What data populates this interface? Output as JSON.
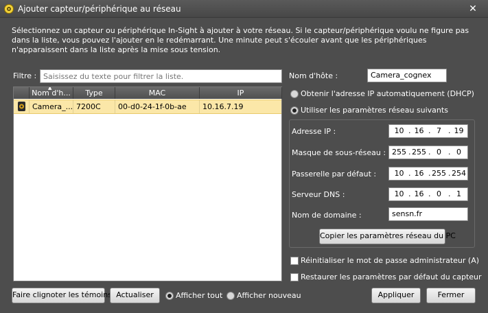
{
  "window": {
    "title": "Ajouter capteur/périphérique au réseau",
    "icon": "cognex-app-icon",
    "close_glyph": "✕"
  },
  "intro_text": "Sélectionnez un capteur ou périphérique In-Sight à ajouter à votre réseau.  Si le capteur/périphérique voulu ne figure pas dans la liste, vous pouvez l'ajouter en le redémarrant.  Une minute peut s'écouler avant que les périphériques n'apparaissent dans la liste après la mise sous tension.",
  "filter": {
    "label": "Filtre :",
    "placeholder": "Saisissez du texte pour filtrer la liste."
  },
  "device_list": {
    "columns": [
      "Nom d'h...",
      "Type",
      "MAC",
      "IP"
    ],
    "rows": [
      {
        "name": "Camera_...",
        "type": "7200C",
        "mac": "00-d0-24-1f-0b-ae",
        "ip": "10.16.7.19"
      }
    ],
    "selected_color": "#fbe7a8"
  },
  "hostname": {
    "label": "Nom d'hôte :",
    "value": "Camera_cognex"
  },
  "ip_mode": {
    "dhcp_label": "Obtenir l'adresse IP automatiquement (DHCP)",
    "static_label": "Utiliser les paramètres réseau suivants",
    "selected": "static"
  },
  "network": {
    "ip_label": "Adresse IP :",
    "ip": [
      "10",
      "16",
      "7",
      "19"
    ],
    "mask_label": "Masque de sous-réseau :",
    "mask": [
      "255",
      "255",
      "0",
      "0"
    ],
    "gateway_label": "Passerelle par défaut :",
    "gateway": [
      "10",
      "16",
      "255",
      "254"
    ],
    "dns_label": "Serveur DNS :",
    "dns": [
      "10",
      "16",
      "0",
      "1"
    ],
    "domain_label": "Nom de domaine :",
    "domain": "sensn.fr",
    "copy_button": "Copier les paramètres réseau du PC"
  },
  "options": {
    "reset_password": "Réinitialiser le mot de passe administrateur (A)",
    "restore_defaults": "Restaurer les paramètres par défaut du capteur"
  },
  "footer": {
    "blink_button": "Faire clignoter les témoins",
    "refresh_button": "Actualiser",
    "show_all": "Afficher tout",
    "show_new": "Afficher nouveau",
    "apply_button": "Appliquer",
    "close_button": "Fermer"
  }
}
